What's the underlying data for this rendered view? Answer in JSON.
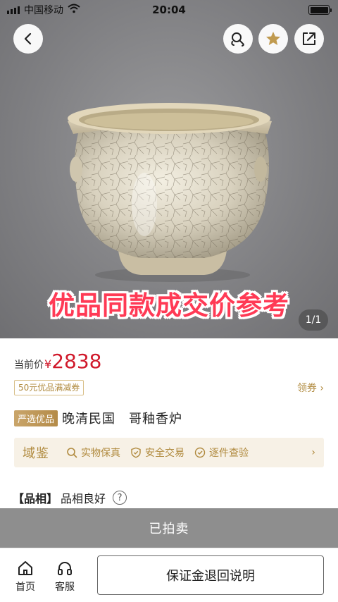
{
  "status_bar": {
    "carrier": "中国移动",
    "time": "20:04"
  },
  "hero": {
    "overlay_text": "优品同款成交价参考",
    "pager": "1/1"
  },
  "price": {
    "label": "当前价",
    "currency": "¥",
    "value": "2838"
  },
  "coupon": {
    "label": "50元优品满减券",
    "link": "领券 ›"
  },
  "product": {
    "tag": "严选优品",
    "title": "晚清民国　哥釉香炉"
  },
  "guarantee": {
    "brand": "域鉴",
    "items": [
      "实物保真",
      "安全交易",
      "逐件查验"
    ],
    "more": "›"
  },
  "condition": {
    "label": "【品相】",
    "value": "品相良好",
    "help": "?"
  },
  "sold_bar": {
    "label": "已拍卖"
  },
  "bottom": {
    "home_label": "首页",
    "service_label": "客服",
    "deposit_button": "保证金退回说明"
  },
  "colors": {
    "price_red": "#d0182a",
    "gold": "#b08a3e",
    "overlay_red": "#ff3a55",
    "sold_gray": "#8e8e8e"
  }
}
